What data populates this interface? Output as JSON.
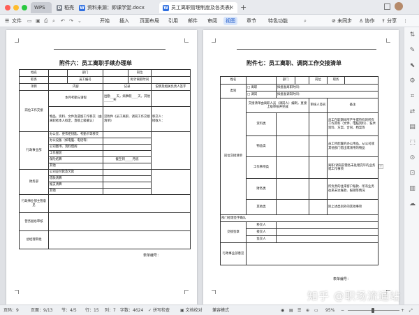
{
  "tabs": [
    {
      "label": "WPS",
      "icon": "wps-logo-icon",
      "color": "#b8bcc4"
    },
    {
      "label": "稻壳",
      "icon": "docer-icon",
      "color": "#9aa0a8"
    },
    {
      "label": "资料来源：即课学堂.docx",
      "icon": "word-doc-icon",
      "color": "#2f6fe0"
    },
    {
      "label": "员工离职管理制度及各类表格",
      "icon": "word-doc-icon",
      "color": "#2f6fe0"
    }
  ],
  "menubar": {
    "file": "文件",
    "items": [
      "开始",
      "插入",
      "页面布局",
      "引用",
      "审阅",
      "视图",
      "章节",
      "特色功能"
    ],
    "active": "视图",
    "mail": "邮件",
    "unsync": "未同步",
    "collab": "协作",
    "share": "分享"
  },
  "left_doc": {
    "title": "附件六：员工离职手续办理单",
    "rows": [
      [
        "姓名",
        "",
        "部门",
        "",
        "岗位",
        ""
      ],
      [
        "职务",
        "",
        "员工编号",
        "",
        "拟计离职时间",
        ""
      ],
      [
        "项目",
        "内容",
        "记录",
        "说明及相关负责人签字"
      ],
      [
        "岗位工作交接",
        "本月考勤与请假",
        "出勤____天，病事假____天，其他______天",
        ""
      ],
      [
        "",
        "物品、资料、文件及遗留工作移交（由离职者本人拟定，直接上级确认）",
        "见附件《员工离职、调岗工作交接清单》",
        "移交人：\n接收人："
      ],
      [
        "行政事业部",
        "办公室、更衣柜钥匙、考勤卡等移交",
        "",
        ""
      ],
      [
        "",
        "办公设备（如电脑、电话等）",
        "",
        ""
      ],
      [
        "",
        "公司图书、资料借阅",
        "",
        ""
      ],
      [
        "",
        "工作服装",
        "",
        ""
      ],
      [
        "",
        "保险结算",
        "截至到_____月底",
        ""
      ],
      [
        "",
        "其他",
        "",
        ""
      ],
      [
        "财务部",
        "公司应付款及欠款",
        "",
        ""
      ],
      [
        "",
        "借款清算",
        "",
        ""
      ],
      [
        "",
        "报支清算",
        "",
        ""
      ],
      [
        "",
        "其他",
        "",
        ""
      ],
      [
        "行政事业部主管意见",
        "",
        "",
        ""
      ],
      [
        "营务副总审核",
        "",
        "",
        ""
      ],
      [
        "总经理审批",
        "",
        "",
        ""
      ]
    ],
    "footer": "表单编号："
  },
  "right_doc": {
    "title": "附件七：员工离职、调岗工作交接清单",
    "row_name": [
      "姓名",
      "部门",
      "岗位",
      "职务"
    ],
    "category_label": "类别",
    "category_opts": [
      "□ 离职",
      "□ 调岗"
    ],
    "category_dates": [
      "拟批准离职时间：",
      "拟批准调岗时间："
    ],
    "handover_label": "岗位交接清单",
    "header": [
      "交接清单由离职人员（调岗人）编制，直接上级审核并完成",
      "审核人签名",
      "备注"
    ],
    "items": [
      "资料类",
      "物品类",
      "工作事项类",
      "财务类",
      "其他类"
    ],
    "notes": [
      "员工在职期间所产生或持有的所有工作资料（文件、电脑资料）、技术资料、方案、合同、档案等",
      "员工所配置的办公用品，从公司或其他部门借出或领用的物品",
      "离职/调岗前需各未处理完毕的业务或工作事项",
      "所负责的往来客户账款、所有业务往来未达账款、报销等情况",
      "除上述类别外的其他事项"
    ],
    "dept_manager": "部门经理签字确认",
    "handover_sign": "交接签章",
    "handover_people": [
      "移交人",
      "接交人",
      "监交人"
    ],
    "admin_opinion": "行政事业部意见",
    "footer": "表单编号："
  },
  "statusbar": {
    "page": "页码：9",
    "pages": "页面：9/13",
    "section": "节：4/5",
    "row": "行：15",
    "col": "列：7",
    "words": "字数：4624",
    "spellcheck": "拼写检查",
    "proofread": "文档校对",
    "compat": "兼容模式",
    "zoom": "95%"
  },
  "watermark": "知乎 @职场流通站"
}
